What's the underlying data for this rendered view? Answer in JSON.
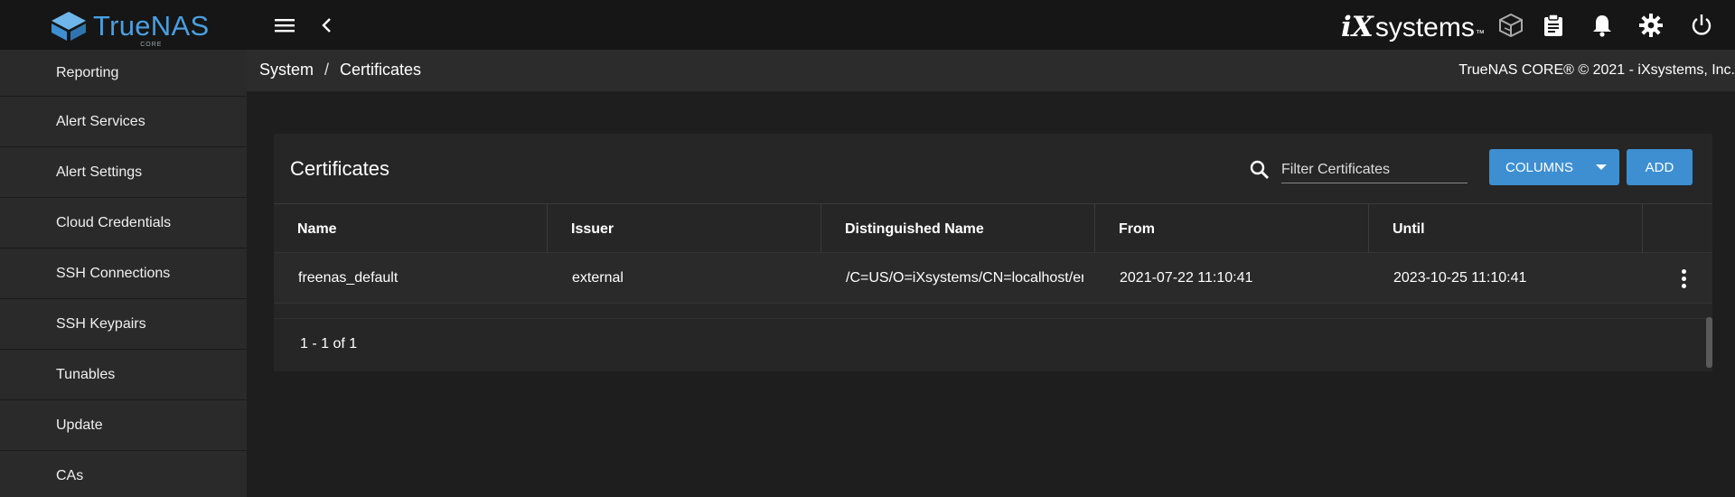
{
  "app": {
    "logo_text": "TrueNAS",
    "logo_sub": "CORE",
    "brand": {
      "ix": "iX",
      "systems": "systems",
      "tm": "™"
    }
  },
  "sidebar": {
    "items": [
      {
        "label": "Reporting"
      },
      {
        "label": "Alert Services"
      },
      {
        "label": "Alert Settings"
      },
      {
        "label": "Cloud Credentials"
      },
      {
        "label": "SSH Connections"
      },
      {
        "label": "SSH Keypairs"
      },
      {
        "label": "Tunables"
      },
      {
        "label": "Update"
      },
      {
        "label": "CAs"
      }
    ]
  },
  "breadcrumb": {
    "parent": "System",
    "separator": "/",
    "current": "Certificates"
  },
  "copyright": "TrueNAS CORE® © 2021 - iXsystems, Inc.",
  "card": {
    "title": "Certificates",
    "filter_placeholder": "Filter Certificates",
    "columns_label": "COLUMNS",
    "add_label": "ADD"
  },
  "table": {
    "headers": [
      "Name",
      "Issuer",
      "Distinguished Name",
      "From",
      "Until"
    ],
    "rows": [
      {
        "name": "freenas_default",
        "issuer": "external",
        "dn": "/C=US/O=iXsystems/CN=localhost/emailAddress=info@ixsystems.com",
        "from": "2021-07-22 11:10:41",
        "until": "2023-10-25 11:10:41"
      }
    ],
    "pager": "1 - 1 of 1"
  },
  "colors": {
    "accent": "#3d8fd1",
    "logo": "#4a9fe0",
    "background": "#1e1e1e"
  }
}
